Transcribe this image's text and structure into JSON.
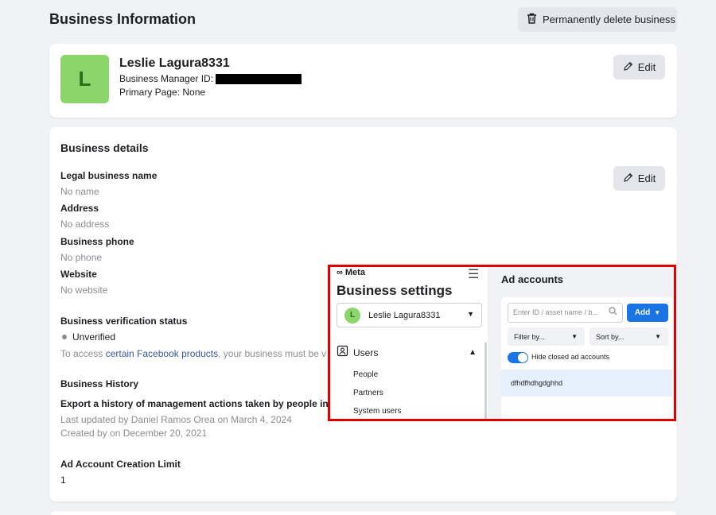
{
  "header": {
    "title": "Business Information",
    "delete_label": "Permanently delete business"
  },
  "business": {
    "avatar_letter": "L",
    "name": "Leslie Lagura8331",
    "manager_id_label": "Business Manager ID:",
    "primary_page": "Primary Page: None",
    "edit_label": "Edit"
  },
  "details": {
    "title": "Business details",
    "edit_label": "Edit",
    "legal_name_label": "Legal business name",
    "legal_name_value": "No name",
    "address_label": "Address",
    "address_value": "No address",
    "phone_label": "Business phone",
    "phone_value": "No phone",
    "website_label": "Website",
    "website_value": "No website",
    "verification_label": "Business verification status",
    "verification_value": "Unverified",
    "access_prefix": "To access ",
    "access_link": "certain Facebook products",
    "access_suffix": ", your business must be v",
    "history_title": "Business History",
    "history_export": "Export a history of management actions taken by people in thi",
    "last_updated": "Last updated by Daniel Ramos Orea on March 4, 2024",
    "created": "Created by on December 20, 2021",
    "ad_limit_label": "Ad Account Creation Limit",
    "ad_limit_value": "1"
  },
  "overlay": {
    "logo": "∞ Meta",
    "settings_title": "Business settings",
    "account_letter": "L",
    "account_name": "Leslie Lagura8331",
    "users_label": "Users",
    "sub_items": [
      "People",
      "Partners",
      "System users"
    ],
    "ad_accounts_title": "Ad accounts",
    "search_placeholder": "Enter ID / asset name / b...",
    "add_label": "Add",
    "filter_label": "Filter by...",
    "sort_label": "Sort by...",
    "toggle_label": "Hide closed ad accounts",
    "account_row": "dfhdfhdhgdghhd",
    "accent_color": "#1b74e4",
    "highlight_color": "#e00000"
  }
}
